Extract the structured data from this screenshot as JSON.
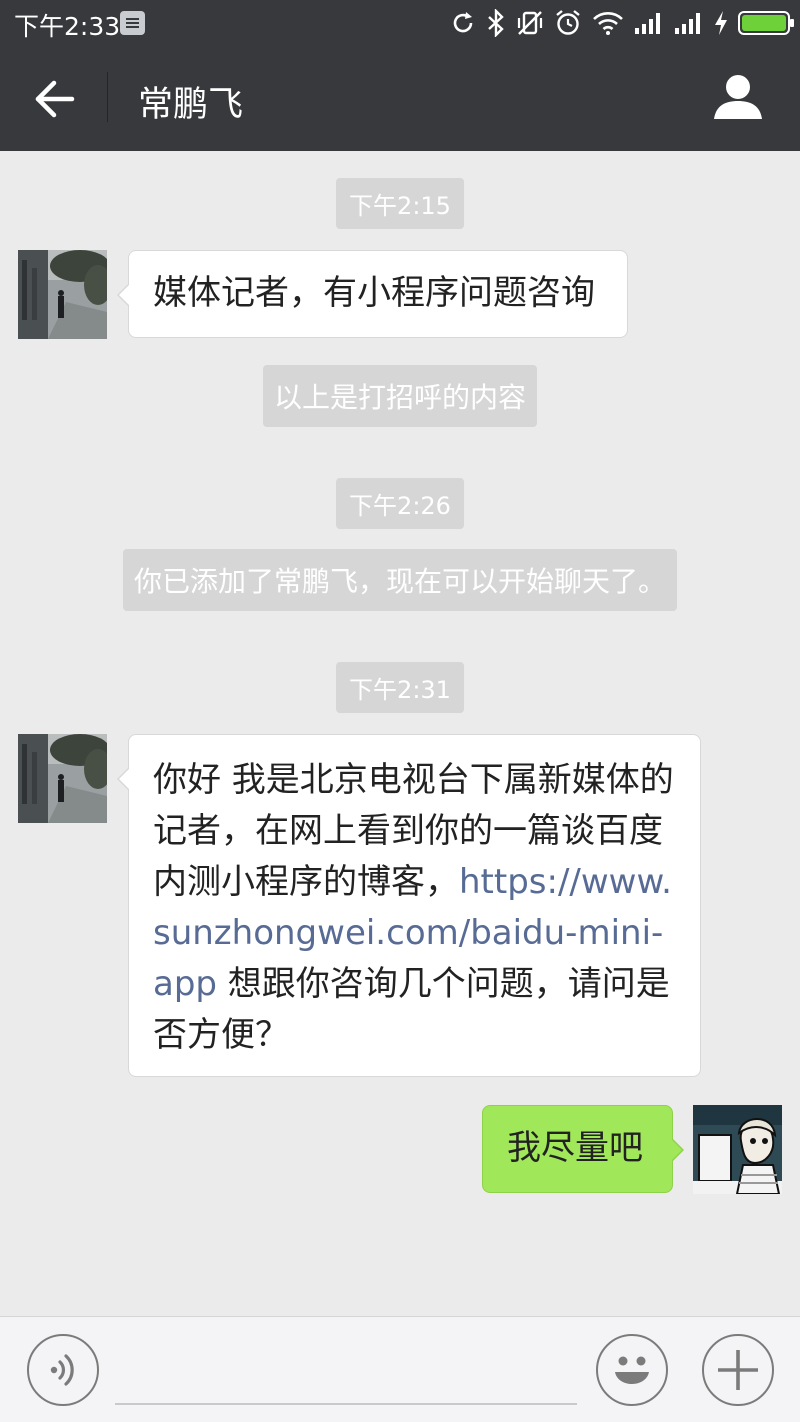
{
  "status_bar": {
    "time": "下午2:33",
    "battery_level": 1.0
  },
  "header": {
    "title": "常鹏飞",
    "back_icon": "arrow-left-icon",
    "profile_icon": "person-icon"
  },
  "messages": {
    "timestamp_1": "下午2:15",
    "msg_1": "媒体记者，有小程序问题咨询",
    "system_1": "以上是打招呼的内容",
    "timestamp_2": "下午2:26",
    "system_2": "你已添加了常鹏飞，现在可以开始聊天了。",
    "timestamp_3": "下午2:31",
    "msg_2": {
      "line_1": "你好 我是北京电视台下属新媒体的",
      "line_2": "记者，在网上看到你的一篇谈百度",
      "line_3_text": "内测小程序的博客，",
      "line_3_link": "https://www.",
      "line_4_link": "sunzhongwei.com/baidu-mini-",
      "line_5_link": "app",
      "line_5_text": " 想跟你咨询几个问题，请问是",
      "line_6": "否方便？"
    },
    "reply_1": "我尽量吧"
  },
  "input_bar": {
    "voice_icon": "voice-icon",
    "emoji_icon": "smiley-icon",
    "more_icon": "plus-icon"
  },
  "colors": {
    "header_bg": "#38393c",
    "chat_bg": "#ebebeb",
    "sent_bubble": "#a0e75a",
    "link": "#576b95",
    "battery": "#6fd13a"
  }
}
